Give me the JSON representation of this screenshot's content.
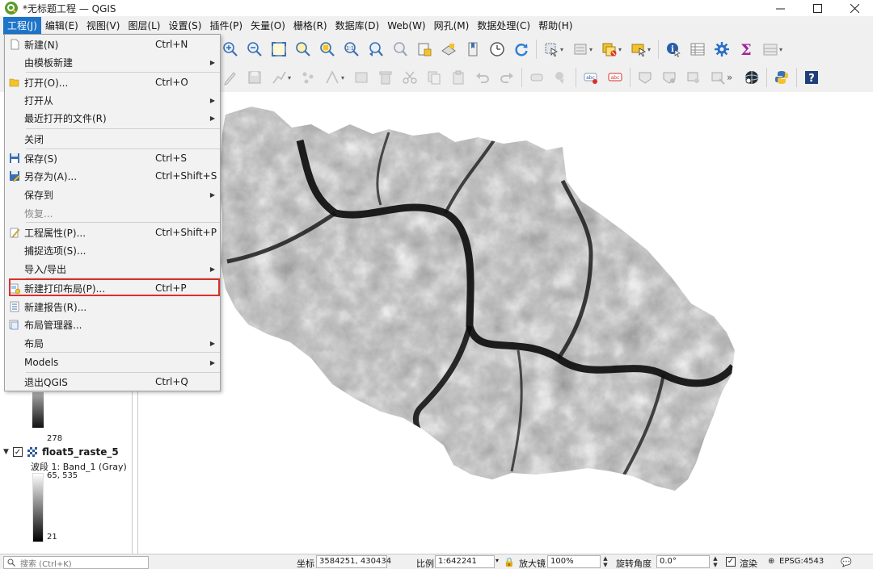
{
  "window": {
    "title": "*无标题工程 — QGIS",
    "icon": "qgis-logo-icon"
  },
  "menubar": {
    "items": [
      {
        "label": "工程(J)",
        "active": true
      },
      {
        "label": "编辑(E)"
      },
      {
        "label": "视图(V)"
      },
      {
        "label": "图层(L)"
      },
      {
        "label": "设置(S)"
      },
      {
        "label": "插件(P)"
      },
      {
        "label": "矢量(O)"
      },
      {
        "label": "栅格(R)"
      },
      {
        "label": "数据库(D)"
      },
      {
        "label": "Web(W)"
      },
      {
        "label": "网孔(M)"
      },
      {
        "label": "数据处理(C)"
      },
      {
        "label": "帮助(H)"
      }
    ]
  },
  "project_menu": {
    "items": [
      {
        "label": "新建(N)",
        "shortcut": "Ctrl+N",
        "icon": "new-file-icon"
      },
      {
        "label": "由模板新建",
        "submenu": true
      },
      {
        "label": "打开(O)...",
        "shortcut": "Ctrl+O",
        "icon": "folder-open-icon"
      },
      {
        "label": "打开从",
        "submenu": true
      },
      {
        "label": "最近打开的文件(R)",
        "submenu": true
      },
      {
        "label": "关闭"
      },
      {
        "label": "保存(S)",
        "shortcut": "Ctrl+S",
        "icon": "save-icon"
      },
      {
        "label": "另存为(A)...",
        "shortcut": "Ctrl+Shift+S",
        "icon": "save-as-icon"
      },
      {
        "label": "保存到",
        "submenu": true
      },
      {
        "label": "恢复...",
        "disabled": true
      },
      {
        "label": "工程属性(P)...",
        "shortcut": "Ctrl+Shift+P",
        "icon": "project-properties-icon"
      },
      {
        "label": "捕捉选项(S)..."
      },
      {
        "label": "导入/导出",
        "submenu": true
      },
      {
        "label": "新建打印布局(P)...",
        "shortcut": "Ctrl+P",
        "icon": "new-print-layout-icon",
        "highlighted": true
      },
      {
        "label": "新建报告(R)...",
        "icon": "new-report-icon"
      },
      {
        "label": "布局管理器...",
        "icon": "layout-manager-icon"
      },
      {
        "label": "布局",
        "submenu": true
      },
      {
        "label": "Models",
        "submenu": true
      },
      {
        "label": "退出QGIS",
        "shortcut": "Ctrl+Q"
      }
    ]
  },
  "layers_panel": {
    "prev_legend_min": "278",
    "layer_name": "float5_raste_5",
    "band_label": "波段 1: Band_1 (Gray)",
    "legend_max": "65, 535",
    "legend_min": "21"
  },
  "statusbar": {
    "search_placeholder": "搜索 (Ctrl+K)",
    "coord_label": "坐标",
    "coord_value": "3584251, 430434",
    "scale_label": "比例",
    "scale_value": "1:642241",
    "magnifier_label": "放大镜",
    "magnifier_value": "100%",
    "rotation_label": "旋转角度",
    "rotation_value": "0.0°",
    "render_label": "渲染",
    "crs_label": "EPSG:4543"
  },
  "colors": {
    "menu_active": "#1e74c9",
    "highlight_box": "#d9302b"
  }
}
